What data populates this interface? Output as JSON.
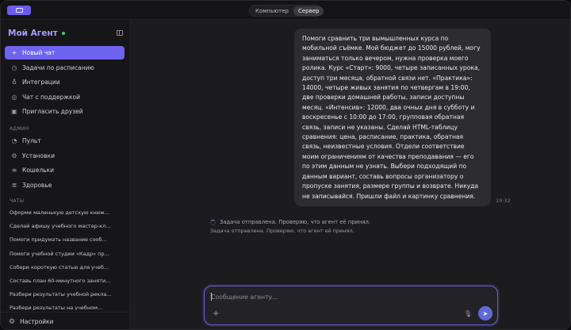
{
  "topbar": {
    "segments": [
      "Компьютер",
      "Сервер"
    ],
    "active_segment": "Сервер"
  },
  "sidebar": {
    "brand": "Мой Агент",
    "items": [
      {
        "label": "Новый чат",
        "icon": "plus-icon"
      },
      {
        "label": "Задачи по расписанию",
        "icon": "clock-icon"
      },
      {
        "label": "Интеграции",
        "icon": "plug-icon"
      },
      {
        "label": "Чат с поддержкой",
        "icon": "support-icon"
      },
      {
        "label": "Пригласить друзей",
        "icon": "gift-icon"
      }
    ],
    "admin_label": "АДМИН",
    "admin_items": [
      {
        "label": "Пульт",
        "icon": "dashboard-icon"
      },
      {
        "label": "Установки",
        "icon": "settings-icon"
      },
      {
        "label": "Кошельки",
        "icon": "wallet-icon"
      },
      {
        "label": "Здоровье",
        "icon": "health-icon"
      }
    ],
    "chats_label": "ЧАТЫ",
    "chats": [
      "Оформи маленькую детскую книж...",
      "Сделай афишу учебного мастер-кл...",
      "Помоги придумать название сооб...",
      "Помоги учебной студии «Кадр» пр...",
      "Собери короткую статью для учеб...",
      "Составь план 60-минутного заняти...",
      "Разбери результаты учебной рекла...",
      "Разбери результаты на учебном..."
    ],
    "settings_label": "Настройки"
  },
  "main": {
    "message": "Помоги сравнить три вымышленных курса по мобильной съёмке. Мой бюджет до 15000 рублей, могу заниматься только вечером, нужна проверка моего ролика. Курс «Старт»: 9000, четыре записанных урока, доступ три месяца, обратной связи нет. «Практика»: 14000, четыре живых занятия по четвергам в 19:00, две проверки домашней работы, записи доступны месяц. «Интенсив»: 12000, два очных дня в субботу и воскресенье с 10:00 до 17:00, групповая обратная связь, записи не указаны. Сделай HTML-таблицу сравнения: цена, расписание, практика, обратная связь, неизвестные условия. Отдели соответствие моим ограничениям от качества преподавания — его по этим данным не узнать. Выбери подходящий по данным вариант, составь вопросы организатору о пропуске занятия, размере группы и возврате. Никуда не записывайся. Пришли файл и картинку сравнения.",
    "message_time": "19:32",
    "status": "Задача отправлена. Проверяю, что агент её принял.",
    "status_sub": "Задача отправлена. Проверяю, что агент её принял.",
    "composer": {
      "placeholder": "Сообщение агенту...",
      "value": ""
    }
  },
  "colors": {
    "accent": "#6f63f2",
    "brand": "#a99cff",
    "online": "#3ecf6b",
    "send": "#5f6bd8"
  }
}
